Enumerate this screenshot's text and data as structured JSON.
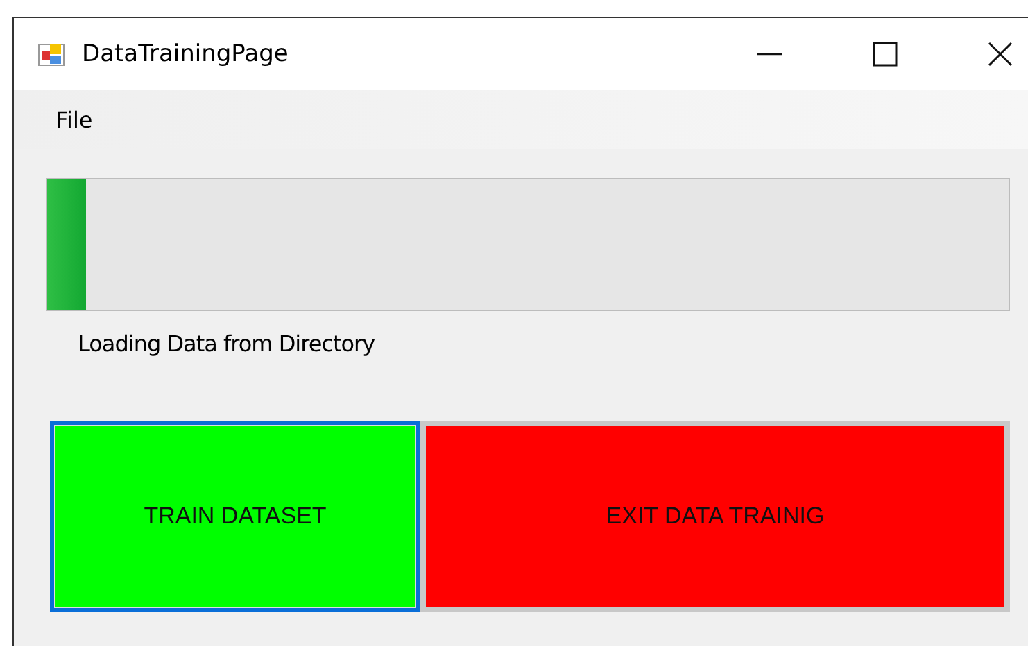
{
  "window": {
    "title": "DataTrainingPage"
  },
  "menu": [
    {
      "label": "File"
    }
  ],
  "progress": {
    "level": 0.04
  },
  "status": "Loading Data from Directory",
  "buttons": [
    {
      "label": "TRAIN DATASET",
      "color": "#00ff00",
      "focused": true
    },
    {
      "label": "EXIT DATA TRAINIG",
      "color": "#ff0000",
      "focused": false
    }
  ]
}
